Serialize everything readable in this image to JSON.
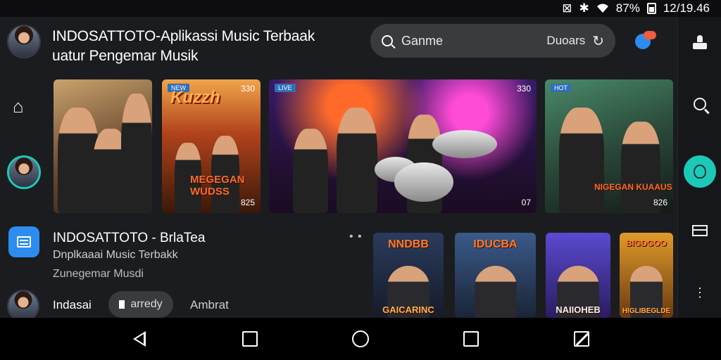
{
  "status_bar": {
    "icons": [
      "nfc-icon",
      "bluetooth-icon",
      "wifi-icon"
    ],
    "battery": "87%",
    "time": "12/19.46"
  },
  "header": {
    "title": "INDOSATTOTO-Aplikassi Music Terbaak uatur Pengemar Musik",
    "search": {
      "query": "Ganme",
      "category": "Duoars",
      "refresh_icon": "refresh-icon"
    }
  },
  "featured": [
    {
      "badge": "",
      "corner": "330",
      "title": "Kuzzh",
      "subtitle": "MEGEGAN WUDSS",
      "number": "825"
    },
    {
      "badge": "",
      "corner": "",
      "title": "",
      "subtitle": "",
      "number": ""
    },
    {
      "badge": "",
      "corner": "330",
      "title": "",
      "subtitle": "",
      "number": "07"
    },
    {
      "badge": "",
      "corner": "",
      "title": "",
      "subtitle": "NIGEGAN KUAAUS",
      "number": "826"
    }
  ],
  "section": {
    "title": "INDOSATTOTO - BrlaTea",
    "line2": "Dnplkaaai Music Terbakk",
    "line3": "Zunegemar Musdi",
    "more": "• •"
  },
  "user": {
    "name": "Indasai",
    "pill_label": "arredy",
    "link": "Ambrat"
  },
  "posters": [
    {
      "title": "NNDBB",
      "bottom": "GAICARINC"
    },
    {
      "title": "IDUCBA",
      "bottom": ""
    },
    {
      "title": "",
      "bottom": "NAIIOHEB"
    },
    {
      "title": "BIGDGOO",
      "bottom": "HIGLIBEGLDE"
    }
  ],
  "colors": {
    "accent_teal": "#1ec8b8",
    "accent_blue": "#2d8cf0",
    "poster_orange": "#ff7a2e"
  }
}
